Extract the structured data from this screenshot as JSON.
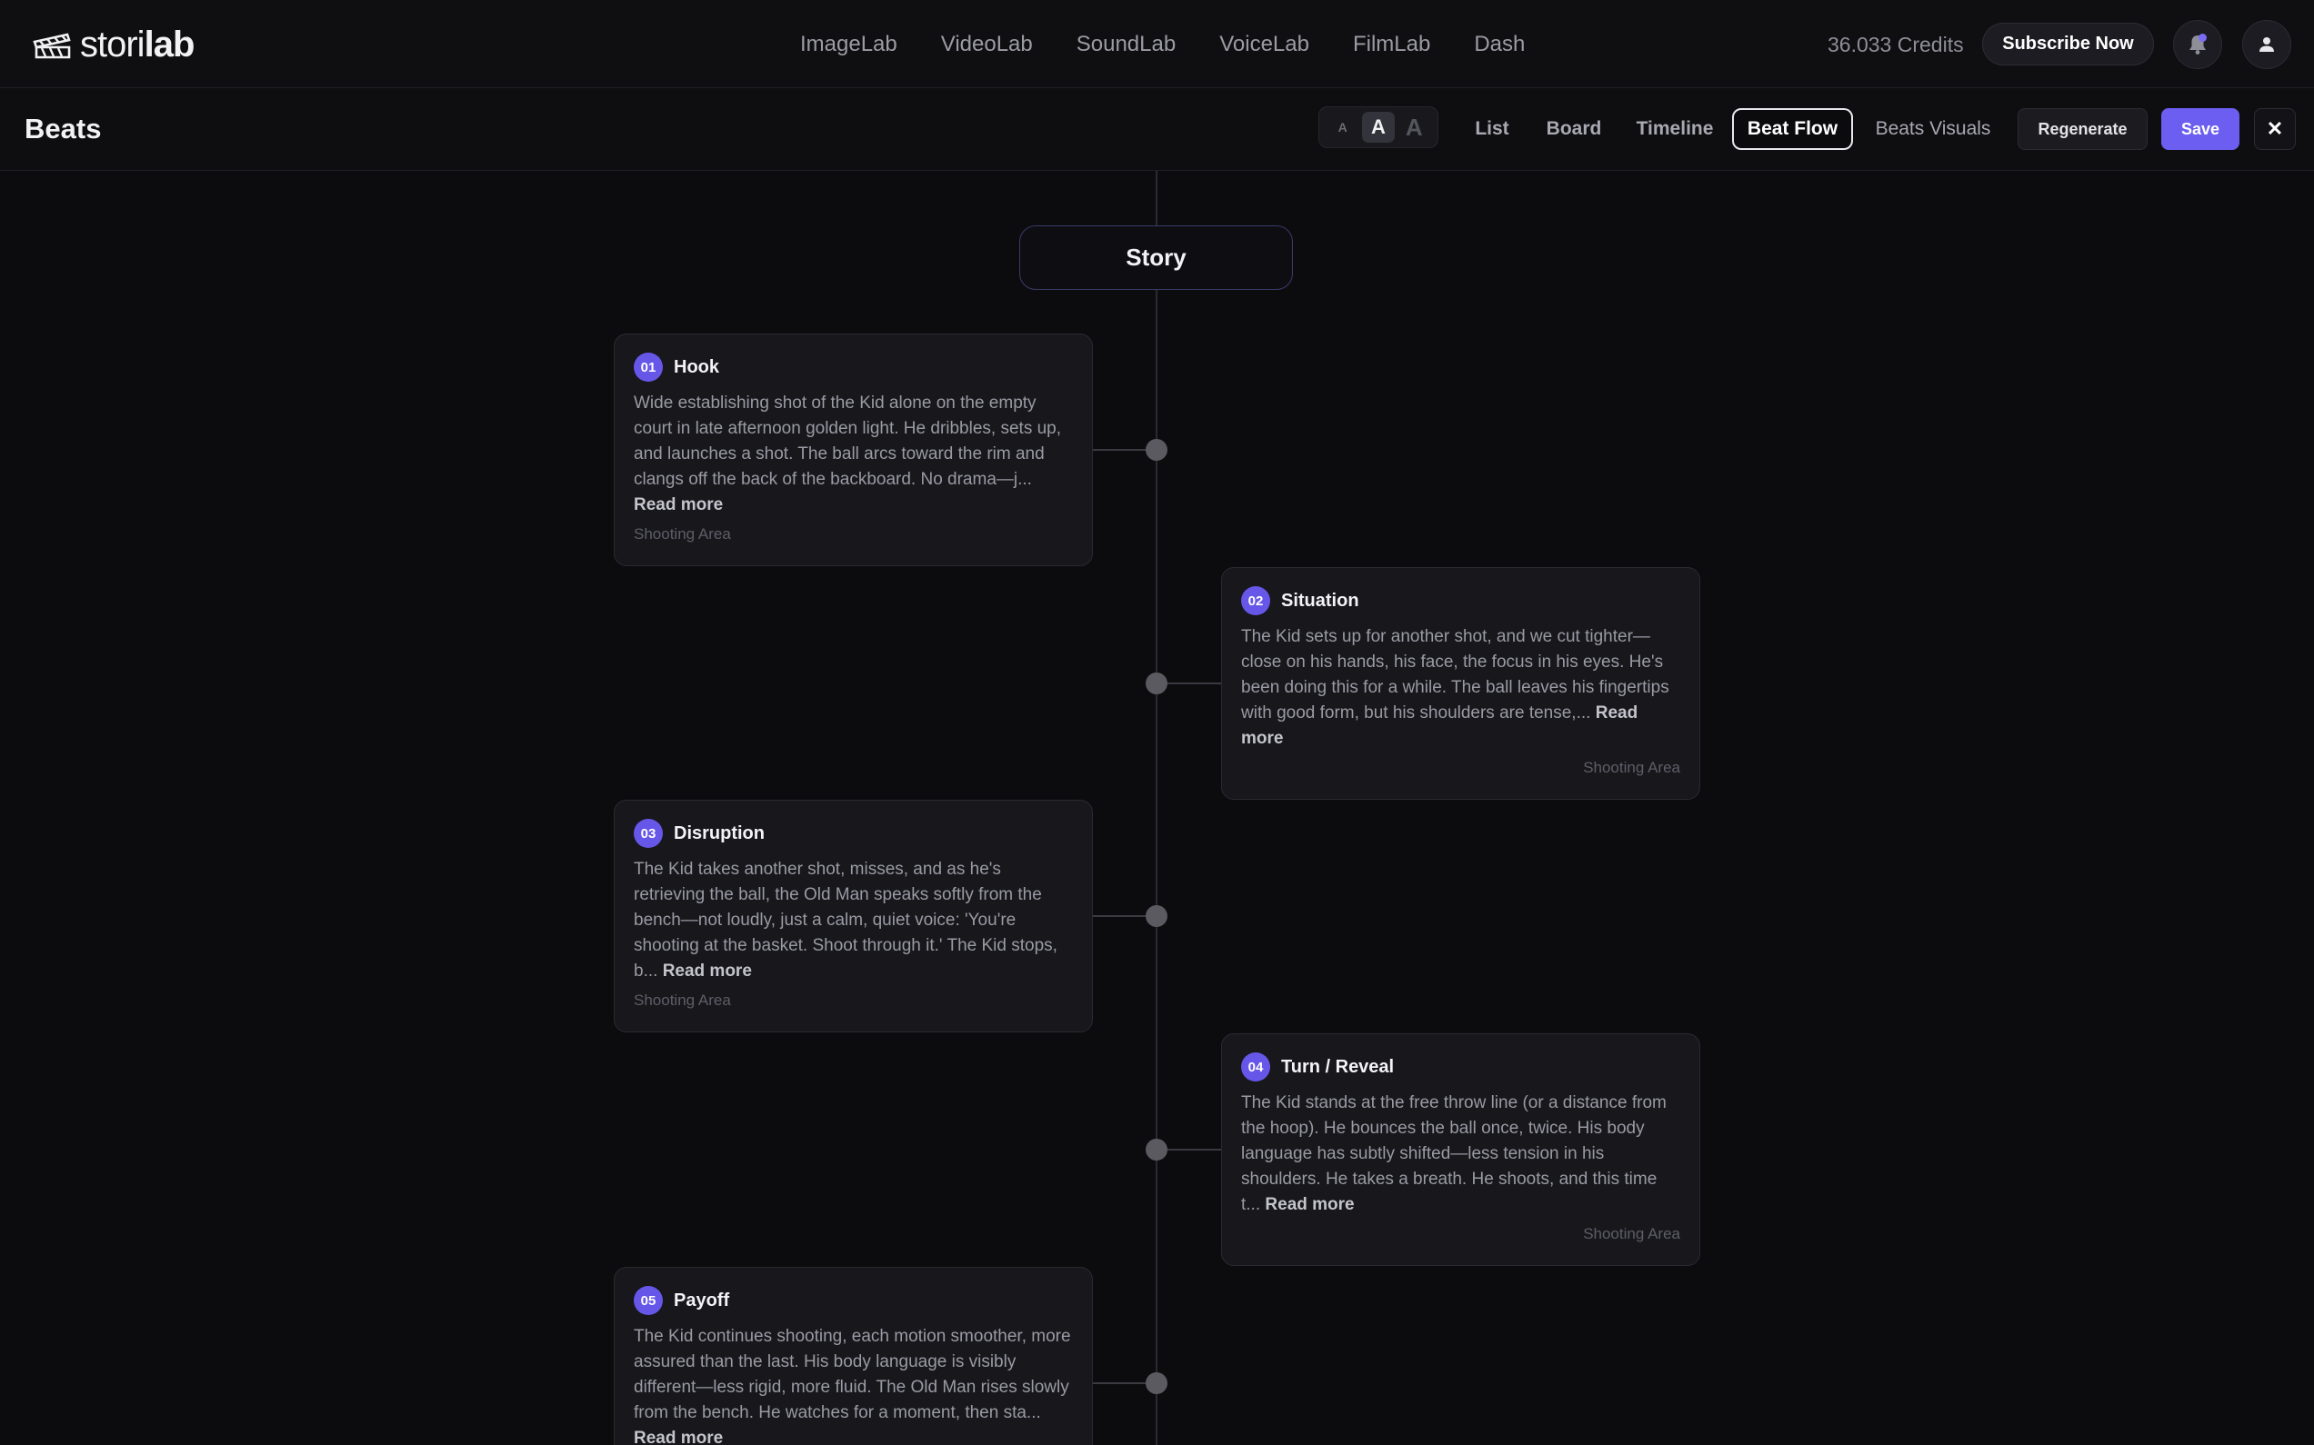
{
  "app": {
    "logo_prefix": "stori",
    "logo_suffix": "lab",
    "logo_icon": "clapperboard-icon"
  },
  "nav": {
    "items": [
      "ImageLab",
      "VideoLab",
      "SoundLab",
      "VoiceLab",
      "FilmLab",
      "Dash"
    ]
  },
  "account": {
    "credits": "36.033 Credits",
    "subscribe_label": "Subscribe Now",
    "bell_icon": "bell-icon",
    "user_icon": "user-icon",
    "accent_color": "#6b5ef0"
  },
  "header": {
    "title": "Beats",
    "font_sizes": [
      "A",
      "A",
      "A"
    ],
    "selected_font_size": "medium",
    "views": [
      "List",
      "Board",
      "Timeline",
      "Beat Flow",
      "Beats Visuals"
    ],
    "active_view": "Beat Flow",
    "regenerate_label": "Regenerate",
    "save_label": "Save",
    "close_label": "✕"
  },
  "flow": {
    "root_label": "Story",
    "read_more_label": "Read more",
    "beats": [
      {
        "number": "01",
        "title": "Hook",
        "text": "Wide establishing shot of the Kid alone on the empty court in late afternoon golden light. He dribbles, sets up, and launches a shot. The ball arcs toward the rim and clangs off the back of the backboard. No drama—j...",
        "location": "Shooting Area",
        "side": "left"
      },
      {
        "number": "02",
        "title": "Situation",
        "text": "The Kid sets up for another shot, and we cut tighter—close on his hands, his face, the focus in his eyes. He's been doing this for a while. The ball leaves his fingertips with good form, but his shoulders are tense,...",
        "location": "Shooting Area",
        "side": "right"
      },
      {
        "number": "03",
        "title": "Disruption",
        "text": "The Kid takes another shot, misses, and as he's retrieving the ball, the Old Man speaks softly from the bench—not loudly, just a calm, quiet voice: 'You're shooting at the basket. Shoot through it.' The Kid stops, b...",
        "location": "Shooting Area",
        "side": "left"
      },
      {
        "number": "04",
        "title": "Turn / Reveal",
        "text": "The Kid stands at the free throw line (or a distance from the hoop). He bounces the ball once, twice. His body language has subtly shifted—less tension in his shoulders. He takes a breath. He shoots, and this time t...",
        "location": "Shooting Area",
        "side": "right"
      },
      {
        "number": "05",
        "title": "Payoff",
        "text": "The Kid continues shooting, each motion smoother, more assured than the last. His body language is visibly different—less rigid, more fluid. The Old Man rises slowly from the bench. He watches for a moment, then sta...",
        "location": "",
        "side": "left"
      }
    ]
  }
}
